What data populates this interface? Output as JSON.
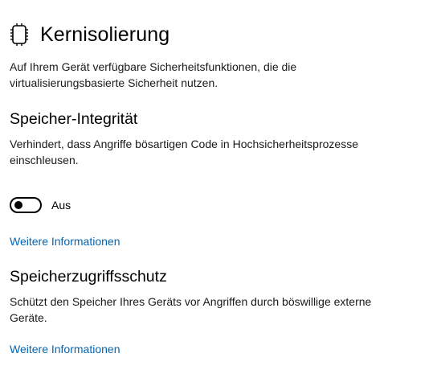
{
  "header": {
    "icon": "chip-icon",
    "title": "Kernisolierung"
  },
  "intro": "Auf Ihrem Gerät verfügbare Sicherheitsfunktionen, die die virtualisierungsbasierte Sicherheit nutzen.",
  "memory_integrity": {
    "title": "Speicher-Integrität",
    "description": "Verhindert, dass Angriffe bösartigen Code in Hochsicherheitsprozesse einschleusen.",
    "toggle": {
      "state_label": "Aus",
      "on": false
    },
    "more_info_link": "Weitere Informationen"
  },
  "memory_access_protection": {
    "title": "Speicherzugriffsschutz",
    "description": "Schützt den Speicher Ihres Geräts vor Angriffen durch böswillige externe Geräte.",
    "more_info_link": "Weitere Informationen"
  },
  "colors": {
    "link": "#0066b4",
    "text": "#000000",
    "background": "#ffffff"
  }
}
